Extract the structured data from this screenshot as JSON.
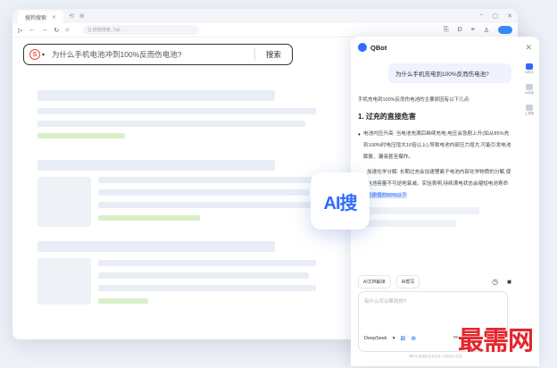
{
  "browser": {
    "tab_title": "搜狗搜索",
    "url_placeholder": "Q 搜狗搜索_Tab"
  },
  "search": {
    "engine_glyph": "S",
    "query": "为什么手机电池冲到100%反而伤电池?",
    "button_label": "搜索"
  },
  "ai_badge": {
    "label": "AI搜"
  },
  "qbot": {
    "title": "QBot",
    "user_question": "为什么手机充电到100%反而伤电池?",
    "intro": "手机充电到100%反而伤电池的主要原因有以下几点:",
    "heading": "1. 过充的直接危害",
    "bullet1": "电池内压升高: 当电池充满后继续充电,电压会急剧上升(如从85%充到100%时电压增大10倍以上),导致电池内部压力增大,可能引发电池膨胀、漏液甚至爆炸。",
    "bullet2_start": "加速化学分解: 长期过充会加速锂离子电池内部化学物质的分解,使电池容量不可逆地衰减。实验表明,持续满电状态会缩短电池寿命",
    "bullet2_highlight": "至原值的80%以下",
    "tool1": "AI文档解读",
    "tool2": "AI帮写",
    "input_placeholder": "有什么可以帮到你?",
    "model": "DeepSeek",
    "footer": "腾讯元宝提供技术支持 | 内容由AI生成"
  },
  "side_nav": [
    {
      "label": "AI助手",
      "active": true
    },
    {
      "label": "AI阅读",
      "active": false
    },
    {
      "label": "工具箱",
      "active": false
    }
  ],
  "watermark": "最需网"
}
